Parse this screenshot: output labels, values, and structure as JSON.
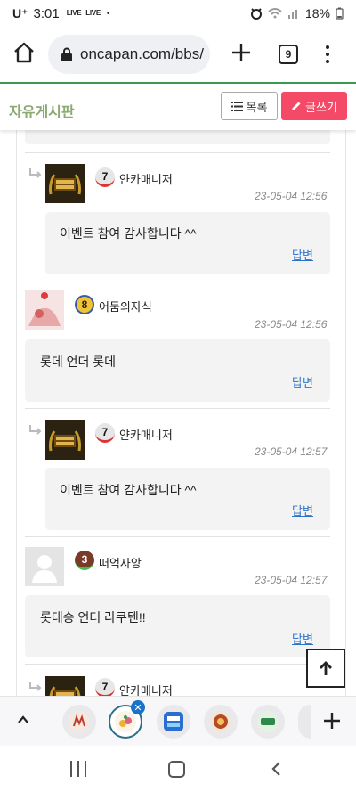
{
  "status_bar": {
    "carrier": "U⁺",
    "time": "3:01",
    "live_badge_1": "LIVE",
    "live_badge_2": "LIVE",
    "dot": "•",
    "battery": "18%"
  },
  "browser": {
    "url": "oncapan.com/bbs/",
    "tab_count": "9"
  },
  "board": {
    "title": "자유게시판",
    "list_label": "목록",
    "write_label": "글쓰기"
  },
  "comments": [
    {
      "username": "얀카매니저",
      "level": "7",
      "date": "23-05-04 12:56",
      "message": "이벤트 참여 감사합니다 ^^",
      "reply_label": "답변",
      "is_reply": true
    },
    {
      "username": "어둠의자식",
      "level": "8",
      "date": "23-05-04 12:56",
      "message": "롯데 언더 롯데",
      "reply_label": "답변",
      "is_reply": false
    },
    {
      "username": "얀카매니저",
      "level": "7",
      "date": "23-05-04 12:57",
      "message": "이벤트 참여 감사합니다 ^^",
      "reply_label": "답변",
      "is_reply": true
    },
    {
      "username": "떠억사앙",
      "level": "3",
      "date": "23-05-04 12:57",
      "message": "롯데승 언더 라쿠텐!!",
      "reply_label": "답변",
      "is_reply": false
    },
    {
      "username": "얀카매니저",
      "level": "7",
      "is_reply": true
    }
  ],
  "colors": {
    "accent_green": "#3a9a52",
    "board_title": "#8aaa72",
    "write_button": "#f44a67",
    "reply_link": "#2a73c9"
  },
  "icons": [
    "home-icon",
    "lock-icon",
    "plus-icon",
    "menu-dots-icon",
    "list-icon",
    "pencil-icon",
    "reply-arrow-icon",
    "arrow-up-icon",
    "caret-up-icon",
    "close-icon"
  ]
}
